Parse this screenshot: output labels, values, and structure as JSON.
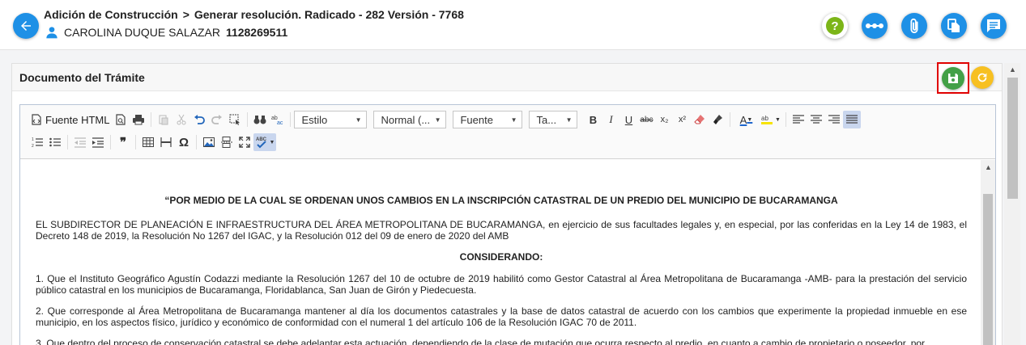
{
  "header": {
    "crumb_1": "Adición de Construcción",
    "crumb_separator": ">",
    "crumb_2": "Generar resolución. Radicado - 282 Versión - 7768",
    "user_name": "CAROLINA DUQUE SALAZAR",
    "user_document": "1128269511",
    "actions": [
      "help-icon",
      "workflow-icon",
      "attachment-icon",
      "copy-icon",
      "comments-icon"
    ]
  },
  "panel": {
    "title": "Documento del Trámite",
    "save_icon": "floppy-disk-icon",
    "refresh_icon": "refresh-icon"
  },
  "toolbar": {
    "source_label": "Fuente HTML",
    "style_combo": "Estilo",
    "format_combo": "Normal (...",
    "font_combo": "Fuente",
    "size_combo": "Ta...",
    "bold": "B",
    "italic": "I",
    "underline": "U",
    "strike": "abc",
    "subscript": "x₂",
    "superscript": "x²",
    "text_color": "A",
    "quote": "❞",
    "special_char": "Ω",
    "spellcheck": "ABC"
  },
  "document": {
    "title": "“POR MEDIO DE LA CUAL SE ORDENAN UNOS CAMBIOS EN LA INSCRIPCIÓN CATASTRAL DE UN PREDIO DEL MUNICIPIO DE BUCARAMANGA",
    "intro": "EL SUBDIRECTOR DE PLANEACIÓN E INFRAESTRUCTURA DEL ÁREA METROPOLITANA DE BUCARAMANGA, en ejercicio de sus facultades legales y, en especial, por las conferidas en la Ley 14 de 1983, el Decreto 148 de 2019, la Resolución No 1267 del IGAC, y la Resolución 012 del 09 de enero de 2020 del AMB",
    "considering": "CONSIDERANDO:",
    "p1": "1. Que el Instituto Geográfico Agustín Codazzi mediante la Resolución 1267 del 10 de octubre de 2019 habilitó como Gestor Catastral al Área Metropolitana de Bucaramanga -AMB- para la prestación del servicio público catastral en los municipios de Bucaramanga, Floridablanca, San Juan de Girón y Piedecuesta.",
    "p2": "2. Que corresponde al Área Metropolitana de Bucaramanga mantener al día los documentos catastrales y la base de datos catastral de acuerdo con los cambios que experimente la propiedad inmueble en ese municipio, en los aspectos físico, jurídico y económico de conformidad con el numeral 1 del artículo 106 de la Resolución IGAC 70 de 2011.",
    "p3": "3. Que dentro del proceso de conservación catastral se debe adelantar esta actuación, dependiendo de la clase de mutación que ocurra respecto al predio, en cuanto a cambio de propietario o poseedor, por"
  },
  "colors": {
    "accent_blue": "#1e90e6",
    "save_green": "#43a047",
    "refresh_yellow": "#f7c021",
    "highlight_red": "#e00000"
  }
}
